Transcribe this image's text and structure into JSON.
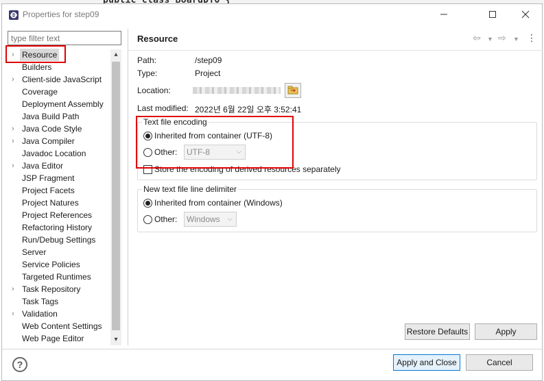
{
  "background": {
    "code": "public class BoardDTO {"
  },
  "window": {
    "title": "Properties for step09",
    "controls": [
      "minimize",
      "maximize",
      "close"
    ]
  },
  "filter": {
    "placeholder": "type filter text"
  },
  "tree": {
    "items": [
      {
        "label": "Resource",
        "expandable": true,
        "selected": true
      },
      {
        "label": "Builders",
        "expandable": false
      },
      {
        "label": "Client-side JavaScript",
        "expandable": true
      },
      {
        "label": "Coverage",
        "expandable": false
      },
      {
        "label": "Deployment Assembly",
        "expandable": false
      },
      {
        "label": "Java Build Path",
        "expandable": false
      },
      {
        "label": "Java Code Style",
        "expandable": true
      },
      {
        "label": "Java Compiler",
        "expandable": true
      },
      {
        "label": "Javadoc Location",
        "expandable": false
      },
      {
        "label": "Java Editor",
        "expandable": true
      },
      {
        "label": "JSP Fragment",
        "expandable": false
      },
      {
        "label": "Project Facets",
        "expandable": false
      },
      {
        "label": "Project Natures",
        "expandable": false
      },
      {
        "label": "Project References",
        "expandable": false
      },
      {
        "label": "Refactoring History",
        "expandable": false
      },
      {
        "label": "Run/Debug Settings",
        "expandable": false
      },
      {
        "label": "Server",
        "expandable": false
      },
      {
        "label": "Service Policies",
        "expandable": false
      },
      {
        "label": "Targeted Runtimes",
        "expandable": false
      },
      {
        "label": "Task Repository",
        "expandable": true
      },
      {
        "label": "Task Tags",
        "expandable": false
      },
      {
        "label": "Validation",
        "expandable": true
      },
      {
        "label": "Web Content Settings",
        "expandable": false
      },
      {
        "label": "Web Page Editor",
        "expandable": false
      }
    ]
  },
  "page": {
    "title": "Resource",
    "path_label": "Path:",
    "path_value": "/step09",
    "type_label": "Type:",
    "type_value": "Project",
    "location_label": "Location:",
    "modified_label": "Last modified:",
    "modified_value": "2022년 6월 22일 오후 3:52:41"
  },
  "encoding": {
    "title": "Text file encoding",
    "inherited_label": "Inherited from container (UTF-8)",
    "other_label": "Other:",
    "other_value": "UTF-8",
    "selected": "inherited",
    "derived_label": "Store the encoding of derived resources separately",
    "derived_checked": false
  },
  "delimiter": {
    "title": "New text file line delimiter",
    "inherited_label": "Inherited from container (Windows)",
    "other_label": "Other:",
    "other_value": "Windows",
    "selected": "inherited"
  },
  "buttons": {
    "restore_defaults": "Restore Defaults",
    "apply": "Apply",
    "apply_and_close": "Apply and Close",
    "cancel": "Cancel",
    "help": "?"
  },
  "colors": {
    "highlight": "#e00000",
    "accent": "#0078d7"
  }
}
